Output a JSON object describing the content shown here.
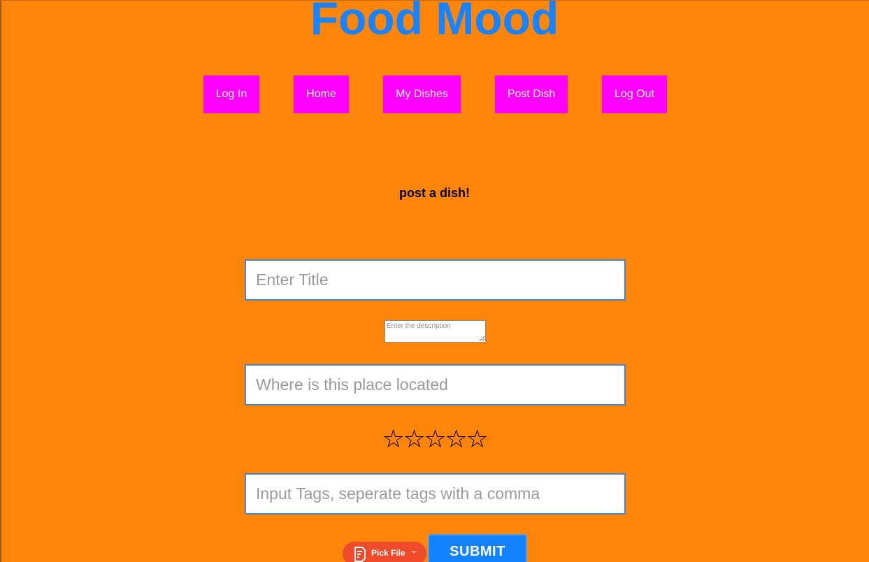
{
  "header": {
    "title": "Food Mood"
  },
  "nav": {
    "items": [
      {
        "label": "Log In"
      },
      {
        "label": "Home"
      },
      {
        "label": "My Dishes"
      },
      {
        "label": "Post Dish"
      },
      {
        "label": "Log Out"
      }
    ]
  },
  "form": {
    "heading": "post a dish!",
    "title_placeholder": "Enter Title",
    "description_placeholder": "Enter the description",
    "location_placeholder": "Where is this place located",
    "rating": {
      "value": 0,
      "max": 5,
      "star_glyph": "☆"
    },
    "tags_placeholder": "Input Tags, seperate tags with a comma",
    "pick_file_label": "Pick File",
    "submit_label": "SUBMIT"
  },
  "colors": {
    "background": "#ff8508",
    "title": "#1882ff",
    "nav_button": "#ff00ff",
    "input_border": "#3d86d6",
    "pick_file": "#ef4a2a",
    "submit": "#1482ff"
  },
  "icons": {
    "pick_file_icon": "document-icon",
    "pick_file_caret": "caret-down-icon",
    "rating_star": "star-outline-icon"
  }
}
